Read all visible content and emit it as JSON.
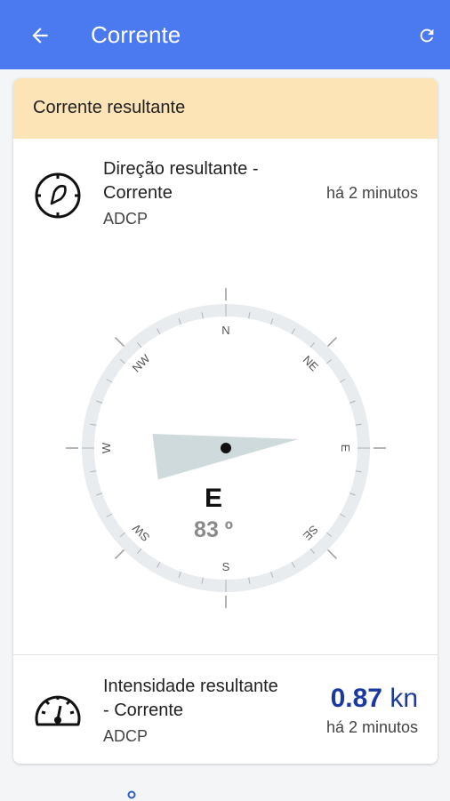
{
  "appbar": {
    "title": "Corrente",
    "back_icon": "arrow-back-icon",
    "refresh_icon": "refresh-icon",
    "color": "#4a79f0"
  },
  "card": {
    "header": "Corrente resultante",
    "header_color": "#fce4b6",
    "direction": {
      "icon": "compass-icon",
      "title_line1": "Direção resultante -",
      "title_line2": "Corrente",
      "source": "ADCP",
      "time": "há 2 minutos",
      "cardinal": "E",
      "degrees": "83 º",
      "compass_labels": {
        "N": "N",
        "NE": "NE",
        "E": "E",
        "SE": "SE",
        "S": "S",
        "SW": "SW",
        "W": "W",
        "NW": "NW"
      },
      "heading_deg": 83
    },
    "intensity": {
      "icon": "speedometer-icon",
      "title_line1": "Intensidade resultante",
      "title_line2": "- Corrente",
      "source": "ADCP",
      "value": "0.87",
      "unit": "kn",
      "time": "há 2 minutos",
      "value_color": "#1c3a9e"
    }
  }
}
